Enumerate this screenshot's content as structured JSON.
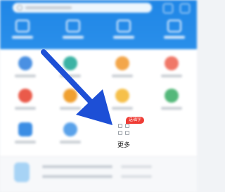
{
  "more": {
    "label": "更多",
    "badge": "送福字"
  },
  "colors": {
    "header_blue": "#2a8fea",
    "arrow_blue": "#1d4fd6",
    "badge_red": "#ef3b34"
  },
  "icons": [
    "search-icon",
    "scan-icon",
    "card-icon",
    "video-icon",
    "wallet-icon",
    "grid-icon",
    "arrow-pointer-icon"
  ]
}
